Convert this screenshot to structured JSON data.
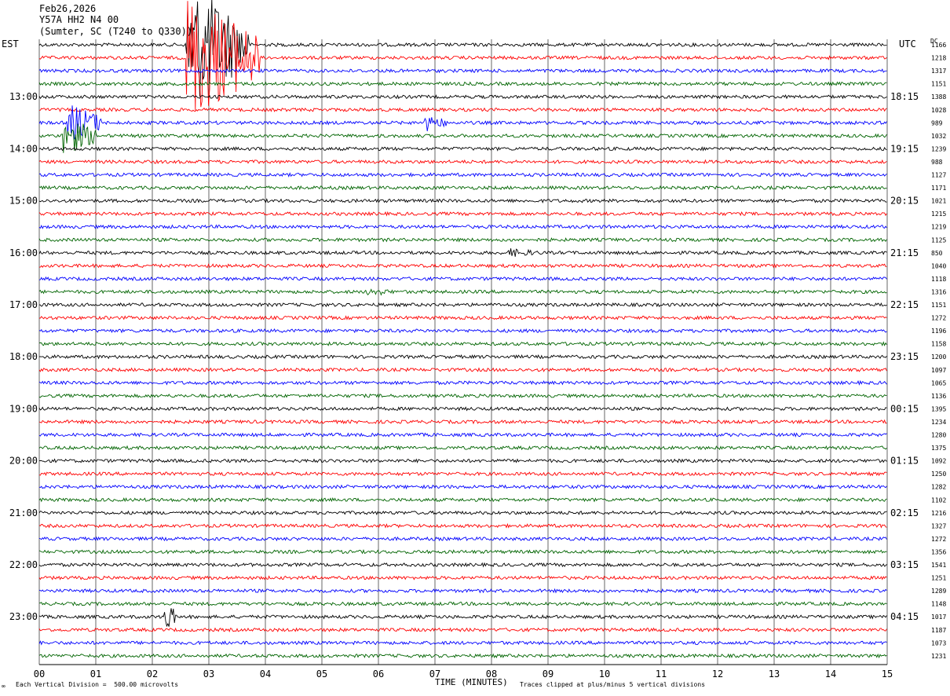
{
  "header": {
    "date": "Feb26,2026",
    "station": "Y57A HH2 N4 00",
    "location": "(Sumter, SC (T240 to Q330))"
  },
  "labels": {
    "left_tz": "EST",
    "right_tz": "UTC",
    "dc_header": "DC",
    "x_axis": "TIME (MINUTES)",
    "scale_note": "Each Vertical Division =  500.00 microvolts",
    "clip_note": "Traces clipped at plus/minus 5 vertical divisions"
  },
  "chart_data": {
    "type": "line",
    "title": "Y57A HH2 N4 00",
    "xlabel": "TIME (MINUTES)",
    "xlim": [
      0,
      15
    ],
    "x_ticks": [
      "00",
      "01",
      "02",
      "03",
      "04",
      "05",
      "06",
      "07",
      "08",
      "09",
      "10",
      "11",
      "12",
      "13",
      "14",
      "15"
    ],
    "left_hour_labels": [
      "13:00",
      "14:00",
      "15:00",
      "16:00",
      "17:00",
      "18:00",
      "19:00",
      "20:00",
      "21:00",
      "22:00",
      "23:00"
    ],
    "right_hour_labels": [
      "18:15",
      "19:15",
      "20:15",
      "21:15",
      "22:15",
      "23:15",
      "00:15",
      "01:15",
      "02:15",
      "03:15",
      "04:15"
    ],
    "trace_colors": [
      "#000000",
      "#ff0000",
      "#0000ff",
      "#006400"
    ],
    "dc_offsets": [
      1166,
      1218,
      1317,
      1151,
      1388,
      1028,
      989,
      1032,
      1239,
      988,
      1127,
      1171,
      1021,
      1215,
      1219,
      1125,
      850,
      1040,
      1118,
      1316,
      1151,
      1272,
      1196,
      1158,
      1200,
      1097,
      1065,
      1136,
      1395,
      1234,
      1280,
      1375,
      1092,
      1250,
      1282,
      1102,
      1216,
      1327,
      1272,
      1356,
      1541,
      1251,
      1289,
      1148,
      1017,
      1187,
      1073,
      1231
    ],
    "events": [
      {
        "trace": 0,
        "minute": 2.6,
        "duration": 1.1,
        "amplitude": "clipped"
      },
      {
        "trace": 1,
        "minute": 2.6,
        "duration": 1.3,
        "amplitude": "clipped"
      },
      {
        "trace": 6,
        "minute": 0.5,
        "duration": 0.6,
        "amplitude": "large"
      },
      {
        "trace": 6,
        "minute": 6.8,
        "duration": 0.4,
        "amplitude": "medium"
      },
      {
        "trace": 7,
        "minute": 0.4,
        "duration": 0.6,
        "amplitude": "large"
      },
      {
        "trace": 16,
        "minute": 8.3,
        "duration": 0.6,
        "amplitude": "small"
      },
      {
        "trace": 19,
        "minute": 5.8,
        "duration": 0.5,
        "amplitude": "small"
      },
      {
        "trace": 44,
        "minute": 2.2,
        "duration": 0.2,
        "amplitude": "large"
      }
    ]
  }
}
